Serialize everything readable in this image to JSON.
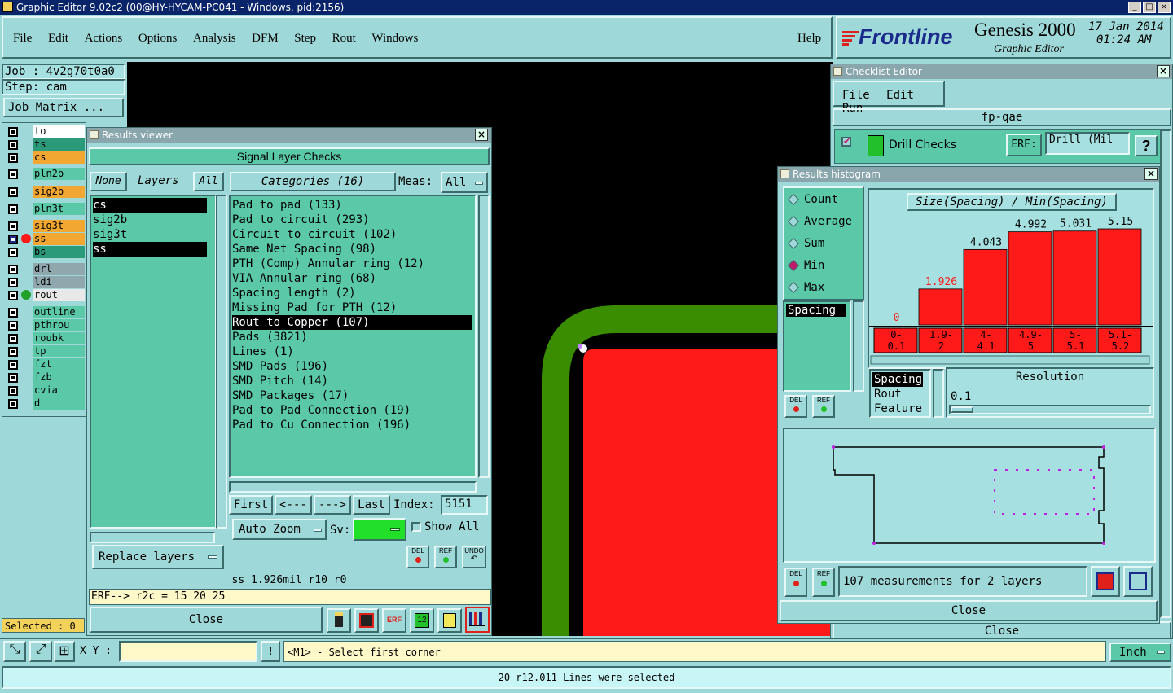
{
  "window": {
    "title": "Graphic Editor 9.02c2 (00@HY-HYCAM-PC041 - Windows, pid:2156)"
  },
  "menu": {
    "items": [
      "File",
      "Edit",
      "Actions",
      "Options",
      "Analysis",
      "DFM",
      "Step",
      "Rout",
      "Windows"
    ],
    "help": "Help"
  },
  "brand": {
    "logo": "Frontline",
    "product": "Genesis 2000",
    "subtitle": "Graphic Editor",
    "date": "17 Jan 2014",
    "time": "01:24 AM"
  },
  "job": {
    "job": "Job : 4v2g70t0a0",
    "step": "Step: cam",
    "matrix": "Job Matrix ..."
  },
  "layers": [
    {
      "name": "to",
      "bg": "#ffffff"
    },
    {
      "name": "ts",
      "bg": "#2a9a7a"
    },
    {
      "name": "cs",
      "bg": "#f2a733"
    },
    {
      "name": "pln2b",
      "bg": "#5bc9a8"
    },
    {
      "name": "sig2b",
      "bg": "#f2a733"
    },
    {
      "name": "pln3t",
      "bg": "#5bc9a8"
    },
    {
      "name": "sig3t",
      "bg": "#f2a733"
    },
    {
      "name": "ss",
      "bg": "#f2a733"
    },
    {
      "name": "bs",
      "bg": "#2a9a7a"
    },
    {
      "name": "drl",
      "bg": "#8fa7ad"
    },
    {
      "name": "ldi",
      "bg": "#8fa7ad"
    },
    {
      "name": "rout",
      "bg": "#e8e8e8"
    },
    {
      "name": "outline",
      "bg": "#5bc9a8"
    },
    {
      "name": "pthrou",
      "bg": "#5bc9a8"
    },
    {
      "name": "roubk",
      "bg": "#5bc9a8"
    },
    {
      "name": "tp",
      "bg": "#5bc9a8"
    },
    {
      "name": "fzt",
      "bg": "#5bc9a8"
    },
    {
      "name": "fzb",
      "bg": "#5bc9a8"
    },
    {
      "name": "cvia",
      "bg": "#5bc9a8"
    },
    {
      "name": "d",
      "bg": "#5bc9a8"
    }
  ],
  "selected": "Selected : 0",
  "results_viewer": {
    "title": "Results viewer",
    "header": "Signal Layer Checks",
    "none": "None",
    "layers_label": "Layers",
    "all": "All",
    "layer_list": [
      "cs",
      "sig2b",
      "sig3t",
      "ss"
    ],
    "categories_label": "Categories (16)",
    "meas_label": "Meas:",
    "meas_value": "All",
    "categories": [
      "Pad to pad (133)",
      "Pad to circuit (293)",
      "Circuit to circuit (102)",
      "Same Net Spacing (98)",
      "PTH (Comp) Annular ring (12)",
      "VIA Annular ring (68)",
      "Spacing length (2)",
      "Missing Pad for PTH (12)",
      "Rout to Copper (107)",
      "Pads (3821)",
      "Lines (1)",
      "SMD Pads (196)",
      "SMD Pitch (14)",
      "SMD Packages (17)",
      "Pad to Pad Connection (19)",
      "Pad to Cu Connection (196)"
    ],
    "selected_category": "Rout to Copper (107)",
    "first": "First",
    "prev": "<---",
    "next": "--->",
    "last": "Last",
    "index_label": "Index:",
    "index_value": "5151",
    "auto_zoom": "Auto Zoom",
    "sv": "Sv:",
    "show_all": "Show All",
    "replace_layers": "Replace layers",
    "del": "DEL",
    "ref": "REF",
    "undo": "UNDO",
    "status": "ss 1.926mil   r10   r0",
    "erf": "ERF--> r2c = 15 20 25",
    "close": "Close"
  },
  "checklist": {
    "title": "Checklist Editor",
    "menu": [
      "File",
      "Edit",
      "Run"
    ],
    "name": "fp-qae",
    "check": "Drill Checks",
    "erf": "ERF:",
    "erf_value": "Drill (Mil",
    "close": "Close"
  },
  "histogram": {
    "title": "Results histogram",
    "modes": [
      "Count",
      "Average",
      "Sum",
      "Min",
      "Max"
    ],
    "selected_mode": "Min",
    "chart_title": "Size(Spacing) / Min(Spacing)",
    "spacing_list": [
      "Spacing"
    ],
    "bars": [
      {
        "range": "0-\n0.1",
        "value": 0
      },
      {
        "range": "1.9-\n2",
        "value": 1.926
      },
      {
        "range": "4-\n4.1",
        "value": 4.043
      },
      {
        "range": "4.9-\n5",
        "value": 4.992
      },
      {
        "range": "5-\n5.1",
        "value": 5.031
      },
      {
        "range": "5.1-\n5.2",
        "value": 5.15
      }
    ],
    "bar_labels": [
      "0",
      "1.926",
      "4.043",
      "4.992",
      "5.031",
      "5.15"
    ],
    "types": [
      "Spacing",
      "Rout",
      "Feature"
    ],
    "resolution_label": "Resolution",
    "resolution_value": "0.1",
    "del": "DEL",
    "ref": "REF",
    "summary": "107 measurements for 2 layers",
    "close": "Close"
  },
  "bottom": {
    "xy_label": "X Y :",
    "prompt": "<M1> - Select first corner",
    "units": "Inch",
    "status": "20 r12.011 Lines were selected"
  },
  "colors": {
    "teal": "#5bc9a8",
    "light": "#9fd8d8",
    "red": "#ff1a1a",
    "green": "#3a8c00",
    "black": "#000000"
  }
}
